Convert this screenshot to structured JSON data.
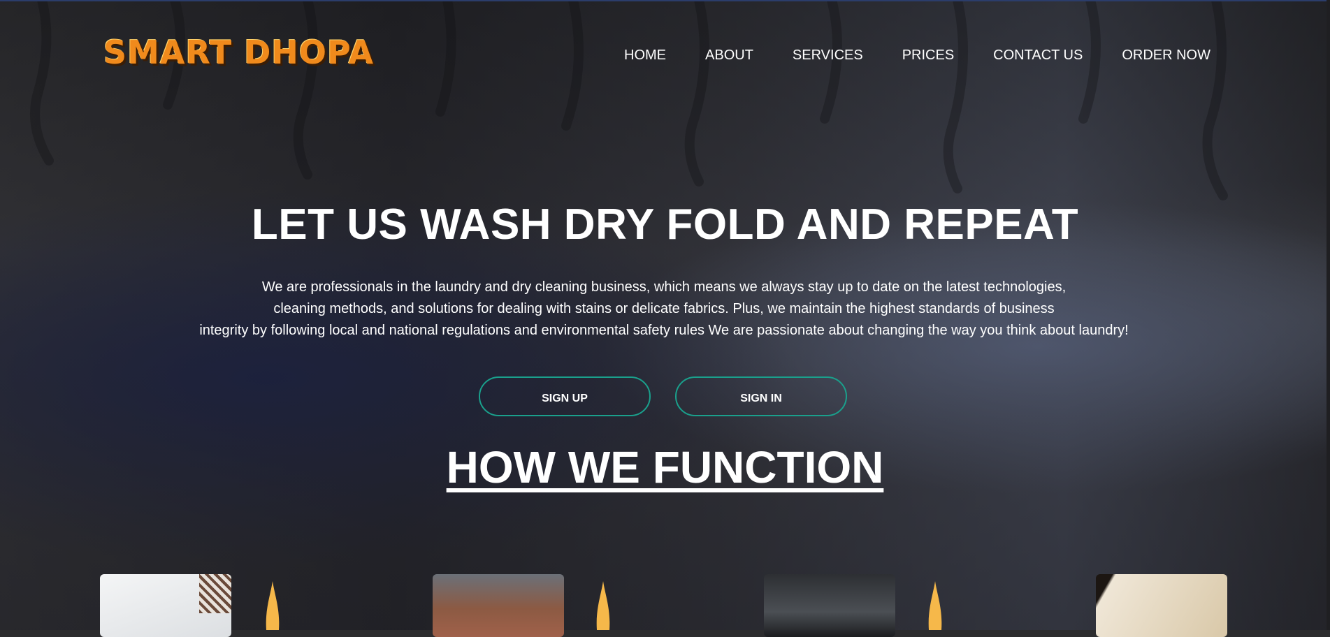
{
  "header": {
    "logo_text": "SMART DHOPA",
    "nav": [
      {
        "label": "HOME"
      },
      {
        "label": "ABOUT"
      },
      {
        "label": "SERVICES"
      },
      {
        "label": "PRICES"
      },
      {
        "label": "CONTACT US"
      },
      {
        "label": "ORDER NOW"
      }
    ]
  },
  "hero": {
    "title": "LET US WASH DRY FOLD AND REPEAT",
    "description_lines": [
      "We are professionals in the laundry and dry cleaning business, which means we always stay up to date on the latest technologies,",
      "cleaning methods, and solutions for dealing with stains or delicate fabrics. Plus, we maintain the highest standards of business",
      "integrity by following local and national regulations and environmental safety rules We are passionate about changing the way you think about laundry!"
    ],
    "signup_label": "SIGN UP",
    "signin_label": "SIGN IN"
  },
  "section": {
    "title": "HOW WE FUNCTION"
  },
  "colors": {
    "button_border": "#1aa08c",
    "logo": "#f08a1c",
    "flame": "#f6b84a",
    "text": "#ffffff"
  }
}
